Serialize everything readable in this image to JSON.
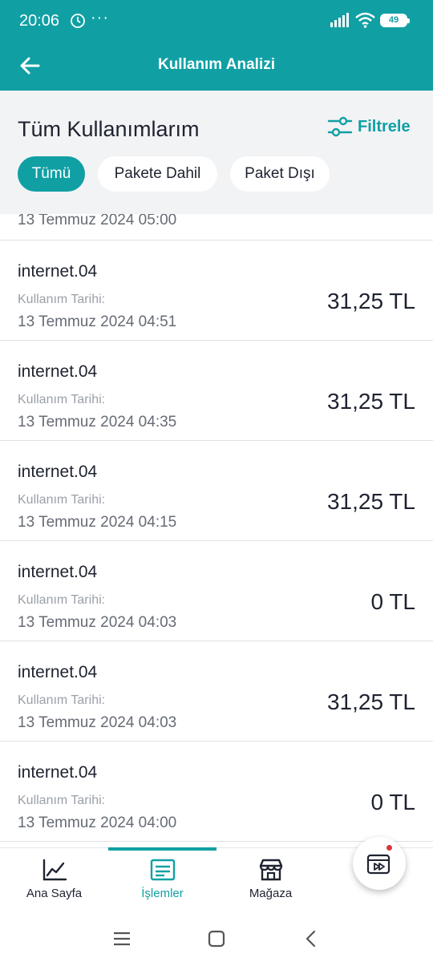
{
  "status_bar": {
    "time": "20:06",
    "more": "···",
    "battery": "49"
  },
  "app_bar": {
    "title": "Kullanım Analizi",
    "back_icon": "arrow-left-icon"
  },
  "header": {
    "title": "Tüm Kullanımlarım",
    "filter_label": "Filtrele",
    "chips": [
      {
        "label": "Tümü",
        "active": true
      },
      {
        "label": "Pakete Dahil",
        "active": false
      },
      {
        "label": "Paket Dışı",
        "active": false
      }
    ]
  },
  "usage_list": {
    "partial_date": "13 Temmuz 2024 05:00",
    "items": [
      {
        "name": "internet.04",
        "label": "Kullanım Tarihi:",
        "date": "13 Temmuz 2024 04:51",
        "amount": "31,25 TL"
      },
      {
        "name": "internet.04",
        "label": "Kullanım Tarihi:",
        "date": "13 Temmuz 2024 04:35",
        "amount": "31,25 TL"
      },
      {
        "name": "internet.04",
        "label": "Kullanım Tarihi:",
        "date": "13 Temmuz 2024 04:15",
        "amount": "31,25 TL"
      },
      {
        "name": "internet.04",
        "label": "Kullanım Tarihi:",
        "date": "13 Temmuz 2024 04:03",
        "amount": "0 TL"
      },
      {
        "name": "internet.04",
        "label": "Kullanım Tarihi:",
        "date": "13 Temmuz 2024 04:03",
        "amount": "31,25 TL"
      },
      {
        "name": "internet.04",
        "label": "Kullanım Tarihi:",
        "date": "13 Temmuz 2024 04:00",
        "amount": "0 TL"
      }
    ]
  },
  "bottom_nav": {
    "items": [
      {
        "label": "Ana Sayfa",
        "icon": "chart-line-icon",
        "active": false
      },
      {
        "label": "İşlemler",
        "icon": "receipt-icon",
        "active": true
      },
      {
        "label": "Mağaza",
        "icon": "store-icon",
        "active": false
      }
    ],
    "fab_icon": "media-forward-icon"
  },
  "colors": {
    "primary": "#10a0a4",
    "header_bg": "#f2f3f5",
    "text": "#1f2330",
    "muted": "#9aa0a8",
    "badge": "#d9363e"
  }
}
